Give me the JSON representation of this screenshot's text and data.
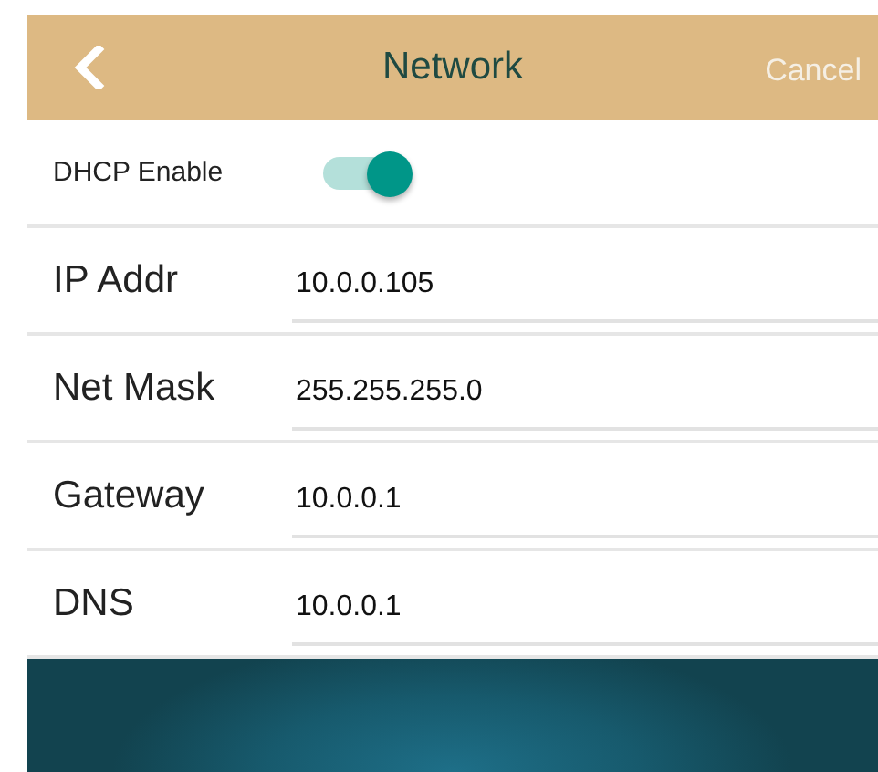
{
  "header": {
    "title": "Network",
    "cancel": "Cancel"
  },
  "dhcp": {
    "label": "DHCP Enable",
    "on": true
  },
  "fields": [
    {
      "label": "IP Addr",
      "value": "10.0.0.105"
    },
    {
      "label": "Net Mask",
      "value": "255.255.255.0"
    },
    {
      "label": "Gateway",
      "value": "10.0.0.1"
    },
    {
      "label": "DNS",
      "value": "10.0.0.1"
    }
  ]
}
